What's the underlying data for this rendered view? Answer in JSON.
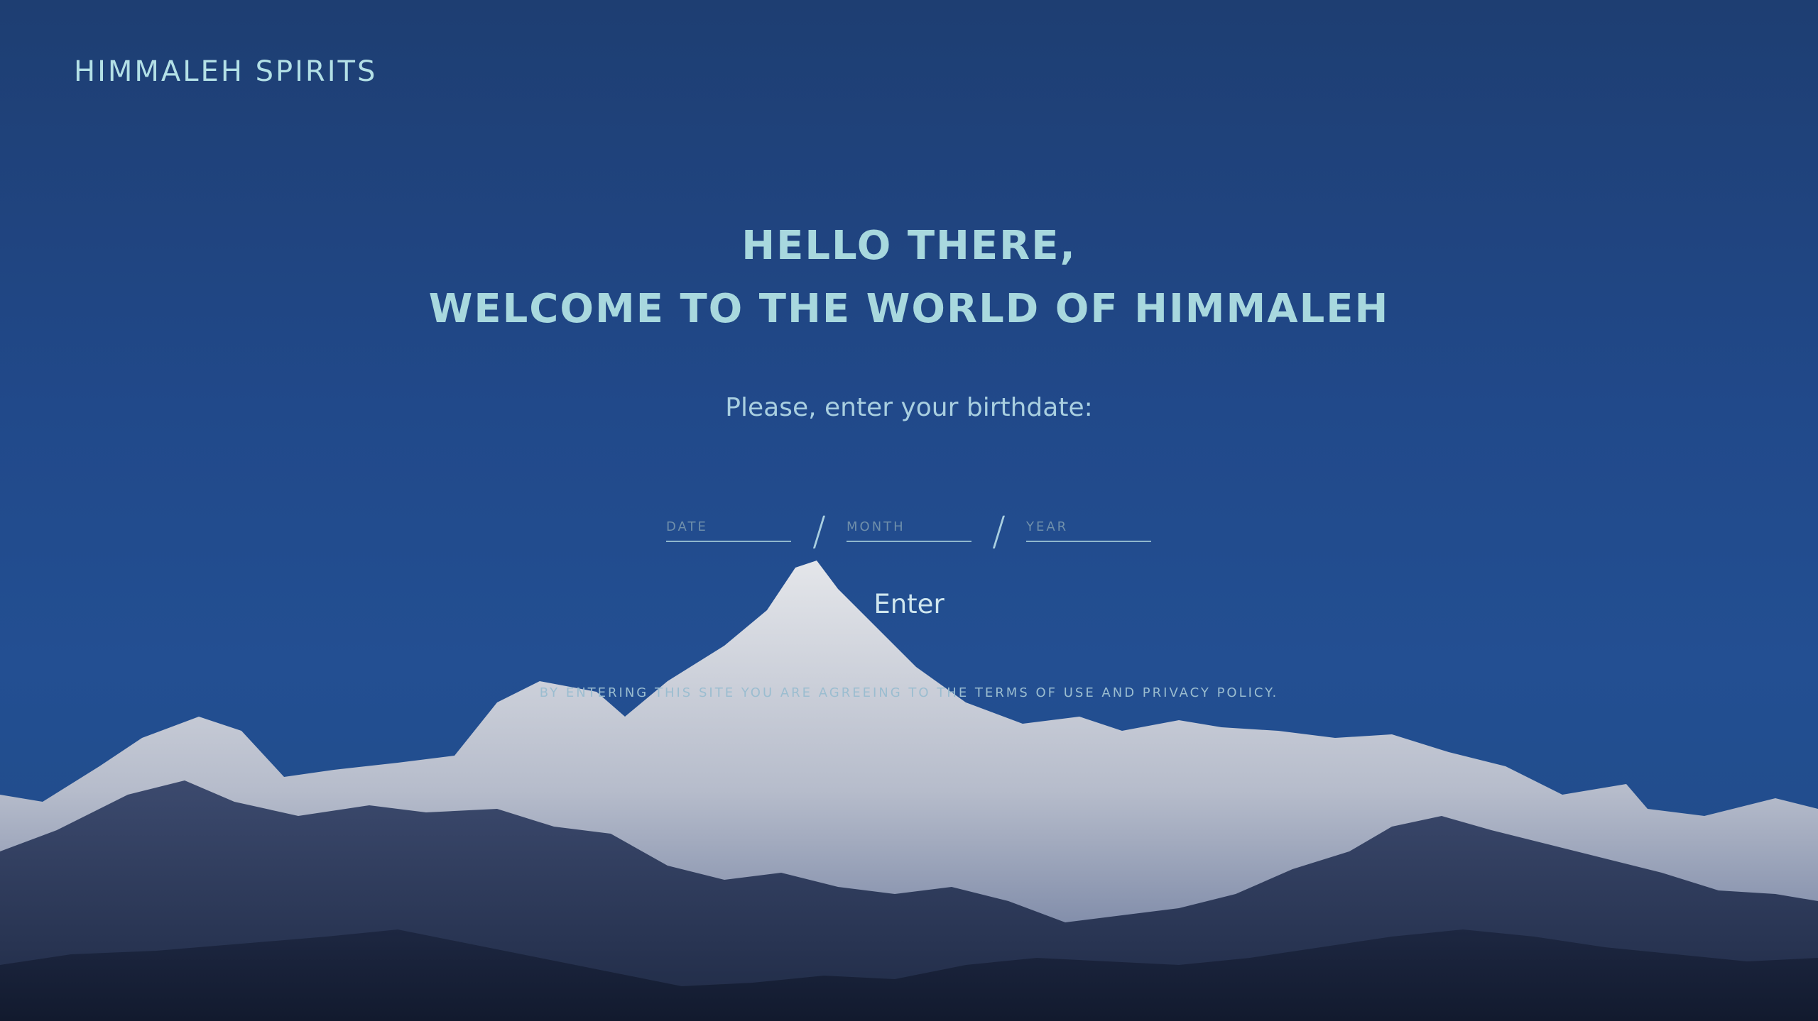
{
  "brand": {
    "logo_text": "HIMMALEH SPIRITS"
  },
  "welcome": {
    "line1": "HELLO THERE,",
    "line2": "WELCOME TO THE WORLD OF HIMMALEH"
  },
  "age_gate": {
    "prompt": "Please, enter your birthdate:",
    "date_placeholder": "DATE",
    "month_placeholder": "MONTH",
    "year_placeholder": "YEAR",
    "separator": "/",
    "enter_label": "Enter",
    "terms_text": "BY ENTERING THIS SITE YOU ARE AGREEING TO THE TERMS OF USE AND PRIVACY POLICY."
  },
  "colors": {
    "sky": "#21498a",
    "text": "#a8d8de",
    "snow": "#cfd3dc"
  }
}
